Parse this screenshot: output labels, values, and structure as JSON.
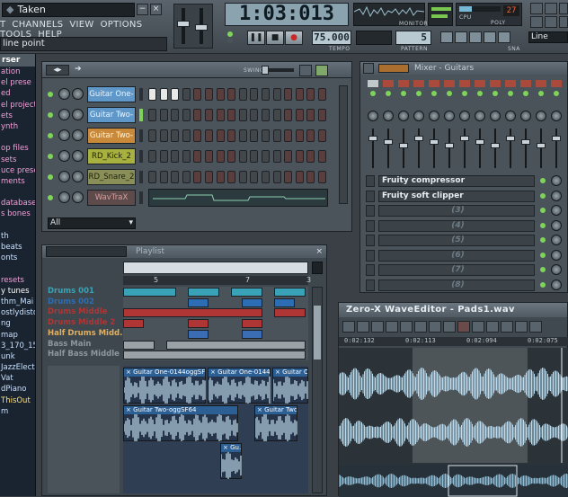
{
  "app": {
    "project_title": "Taken",
    "menu": [
      "T",
      "CHANNELS",
      "VIEW",
      "OPTIONS",
      "TOOLS",
      "HELP"
    ],
    "hint": "line point",
    "time_display": "1:03:013",
    "monitor_label": "MONITOR",
    "cpu_label": "CPU",
    "poly_label": "POLY",
    "cpu_value": "27",
    "tempo_label": "TEMPO",
    "tempo_value": "75.000",
    "pattern_label": "PATTERN",
    "pattern_value": "5",
    "snap_label": "SNA",
    "snap_mode": "Line",
    "transport": {
      "pause": "❚❚",
      "stop": "■",
      "record": "●"
    }
  },
  "browser": {
    "header": "rser",
    "items": [
      {
        "label": "ation",
        "color": "#f0a0d8"
      },
      {
        "label": "el prese",
        "color": "#f0a0d8"
      },
      {
        "label": "ed",
        "color": "#f0a0d8"
      },
      {
        "label": "el project",
        "color": "#f0a0d8"
      },
      {
        "label": "ets",
        "color": "#f0a0d8"
      },
      {
        "label": "ynth",
        "color": "#f0a0d8"
      },
      {
        "label": "",
        "color": "#f0a0d8"
      },
      {
        "label": "op files",
        "color": "#f0a0d8"
      },
      {
        "label": "sets",
        "color": "#f0a0d8"
      },
      {
        "label": "uce prese",
        "color": "#f0a0d8"
      },
      {
        "label": "ments",
        "color": "#f0a0d8"
      },
      {
        "label": "",
        "color": "#f0a0d8"
      },
      {
        "label": "database",
        "color": "#f0a0d8"
      },
      {
        "label": "s bones",
        "color": "#f0a0d8"
      },
      {
        "label": "",
        "color": "#f0a0d8"
      },
      {
        "label": "th",
        "color": "#c8e0ff"
      },
      {
        "label": "beats",
        "color": "#c8e0ff"
      },
      {
        "label": "onts",
        "color": "#c8e0ff"
      },
      {
        "label": "",
        "color": "#c8e0ff"
      },
      {
        "label": "resets",
        "color": "#f0a0d8"
      },
      {
        "label": "y tunes",
        "color": "#ffffff"
      },
      {
        "label": "thm_Mai",
        "color": "#c8e0ff"
      },
      {
        "label": "ostlydisto",
        "color": "#c8e0ff"
      },
      {
        "label": "ng",
        "color": "#c8e0ff"
      },
      {
        "label": "map",
        "color": "#c8e0ff"
      },
      {
        "label": "3_170_15",
        "color": "#c8e0ff"
      },
      {
        "label": "unk",
        "color": "#c8e0ff"
      },
      {
        "label": "JazzElect",
        "color": "#c8e0ff"
      },
      {
        "label": "Vat",
        "color": "#c8e0ff"
      },
      {
        "label": "dPiano",
        "color": "#c8e0ff"
      },
      {
        "label": "ThisOut",
        "color": "#ffe070"
      },
      {
        "label": "m",
        "color": "#c8e0ff"
      }
    ]
  },
  "channel_rack": {
    "swing_label": "SWING",
    "channels": [
      {
        "name": "Guitar One-",
        "bg": "#5f98c8",
        "color": "#eaf4ff",
        "steps": [
          1,
          1,
          1,
          0,
          0,
          0,
          0,
          0,
          0,
          0,
          0,
          0,
          0,
          0,
          0,
          0
        ]
      },
      {
        "name": "Guitar Two-",
        "bg": "#5f98c8",
        "color": "#eaf4ff",
        "steps": [
          0,
          0,
          0,
          0,
          0,
          0,
          0,
          0,
          0,
          0,
          0,
          0,
          0,
          0,
          0,
          0
        ]
      },
      {
        "name": "Guitar Two-",
        "bg": "#c88a3a",
        "color": "#fff3dd",
        "steps": [
          0,
          0,
          0,
          0,
          0,
          0,
          0,
          0,
          0,
          0,
          0,
          0,
          0,
          0,
          0,
          0
        ]
      },
      {
        "name": "RD_Kick_2",
        "bg": "#a8b040",
        "color": "#1c2008",
        "steps": [
          0,
          0,
          0,
          0,
          0,
          0,
          0,
          0,
          0,
          0,
          0,
          0,
          0,
          0,
          0,
          0
        ]
      },
      {
        "name": "RD_Snare_2",
        "bg": "#8a8f5a",
        "color": "#1c2008",
        "steps": [
          0,
          0,
          0,
          0,
          0,
          0,
          0,
          0,
          0,
          0,
          0,
          0,
          0,
          0,
          0,
          0
        ]
      },
      {
        "name": "WavTraX",
        "bg": "#5d4a4a",
        "color": "#d9a0a0",
        "steps": []
      }
    ],
    "filter_label": "All"
  },
  "playlist": {
    "title": "Playlist",
    "bar_numbers": [
      "5",
      "7",
      "3"
    ],
    "tracks": [
      {
        "name": "Drums 001",
        "color": "#39a2b6"
      },
      {
        "name": "Drums 002",
        "color": "#2d6db4"
      },
      {
        "name": "Drums Middle",
        "color": "#b03636"
      },
      {
        "name": "Drums Middle 2",
        "color": "#b03636"
      },
      {
        "name": "Half Drums Midd...",
        "color": "#e0b060"
      },
      {
        "name": "Bass Main",
        "color": "#8e979e"
      },
      {
        "name": "Half Bass Middle",
        "color": "#8e979e"
      }
    ],
    "audio_clips": [
      {
        "label": "Guitar One-0144oggSF64",
        "track": "A"
      },
      {
        "label": "Guitar One-0144o...",
        "track": "A"
      },
      {
        "label": "Guitar One-01...",
        "track": "A"
      },
      {
        "label": "Guitar Two-oggSF64",
        "track": "B"
      },
      {
        "label": "Guitar Two-o...",
        "track": "B"
      },
      {
        "label": "Gu...",
        "track": "C"
      }
    ]
  },
  "mixer": {
    "title": "Mixer - Guitars",
    "fx_slots": [
      {
        "label": "Fruity compressor",
        "empty": false
      },
      {
        "label": "Fruity soft clipper",
        "empty": false
      },
      {
        "label": "(3)",
        "empty": true
      },
      {
        "label": "(4)",
        "empty": true
      },
      {
        "label": "(5)",
        "empty": true
      },
      {
        "label": "(6)",
        "empty": true
      },
      {
        "label": "(7)",
        "empty": true
      },
      {
        "label": "(8)",
        "empty": true
      }
    ]
  },
  "wave_editor": {
    "title": "Zero-X WaveEditor - Pads1.wav",
    "timeline": [
      "0:02:132",
      "0:02:113",
      "0:02:094",
      "0:02:075"
    ],
    "selection_fraction": [
      0.32,
      0.82
    ],
    "colors": {
      "wave": "#b8dcf0",
      "bg": "#2c3338",
      "selection": "#3d4448"
    }
  },
  "colors": {
    "led_green": "#7fd35a",
    "step_off": "#42474b",
    "step_on": "#e8e8e8",
    "accent_blue": "#2c5f94"
  }
}
